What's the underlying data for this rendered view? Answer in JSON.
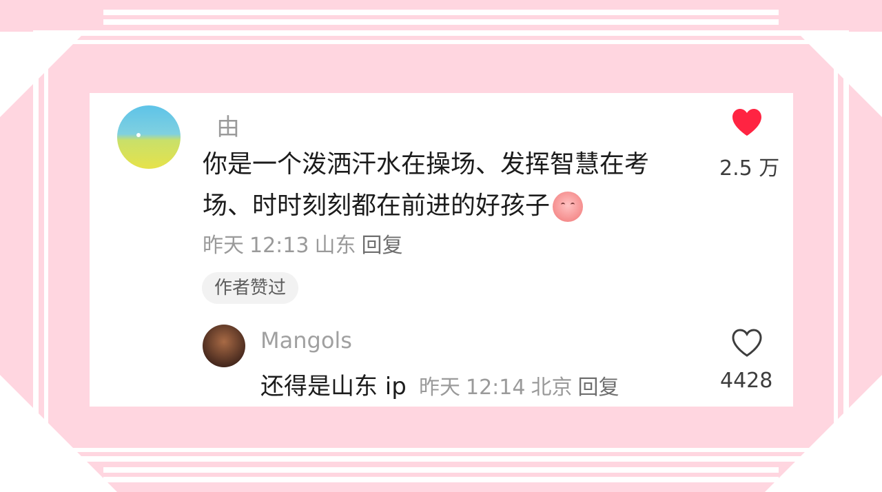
{
  "comment": {
    "username": "由",
    "text": "你是一个泼洒汗水在操场、发挥智慧在考场、时时刻刻都在前进的好孩子",
    "emoji_icon": "peach-face-emoji-icon",
    "meta": {
      "date": "昨天",
      "time": "12:13",
      "location": "山东",
      "reply": "回复"
    },
    "author_liked": "作者赞过",
    "like_count": "2.5 万",
    "liked": true
  },
  "reply": {
    "username": "Mangols",
    "text": "还得是山东 ip",
    "meta": {
      "date": "昨天",
      "time": "12:14",
      "location": "北京",
      "reply": "回复"
    },
    "like_count": "4428",
    "liked": false
  },
  "colors": {
    "background_pink": "#ffd6e0",
    "heart_red": "#ff2442",
    "text_primary": "#1c1c1c",
    "text_secondary": "#9a9a9a"
  }
}
